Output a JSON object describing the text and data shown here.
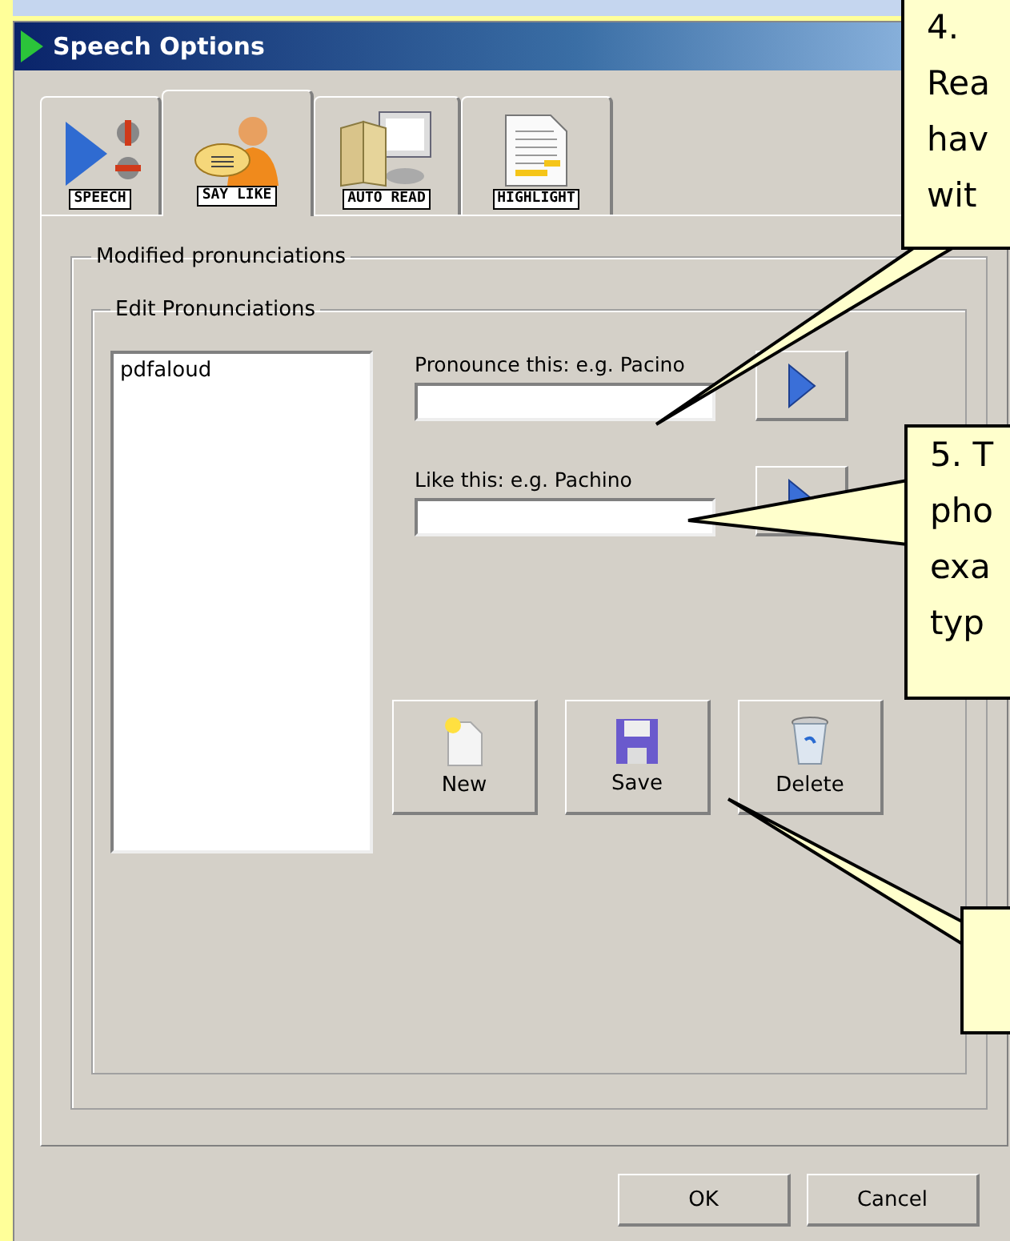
{
  "window": {
    "title": "Speech Options"
  },
  "tabs": [
    {
      "label": "SPEECH",
      "kind": "speech",
      "selected": false
    },
    {
      "label": "SAY LIKE",
      "kind": "saylike",
      "selected": true
    },
    {
      "label": "AUTO READ",
      "kind": "autoread",
      "selected": false
    },
    {
      "label": "HIGHLIGHT",
      "kind": "highlight",
      "selected": false
    }
  ],
  "outer_group": {
    "title": "Modified pronunciations"
  },
  "inner_group": {
    "title": "Edit Pronunciations"
  },
  "pronunciation_list": {
    "items": [
      {
        "label": "pdfaloud",
        "selected": false
      }
    ]
  },
  "fields": [
    {
      "label": "Pronounce this: e.g. Pacino"
    },
    {
      "label": "Like this: e.g. Pachino"
    }
  ],
  "actions": [
    {
      "label": "New",
      "kind": "new"
    },
    {
      "label": "Save",
      "kind": "save"
    },
    {
      "label": "Delete",
      "kind": "delete"
    }
  ],
  "dialog_buttons": [
    "OK",
    "Cancel"
  ],
  "callouts": [
    {
      "kind": "note",
      "lines": [
        "4.",
        "Rea",
        "hav",
        "wit"
      ]
    },
    {
      "kind": "note",
      "lines": [
        "5. T",
        "pho",
        "exa",
        "typ"
      ]
    },
    {
      "kind": "note"
    }
  ]
}
